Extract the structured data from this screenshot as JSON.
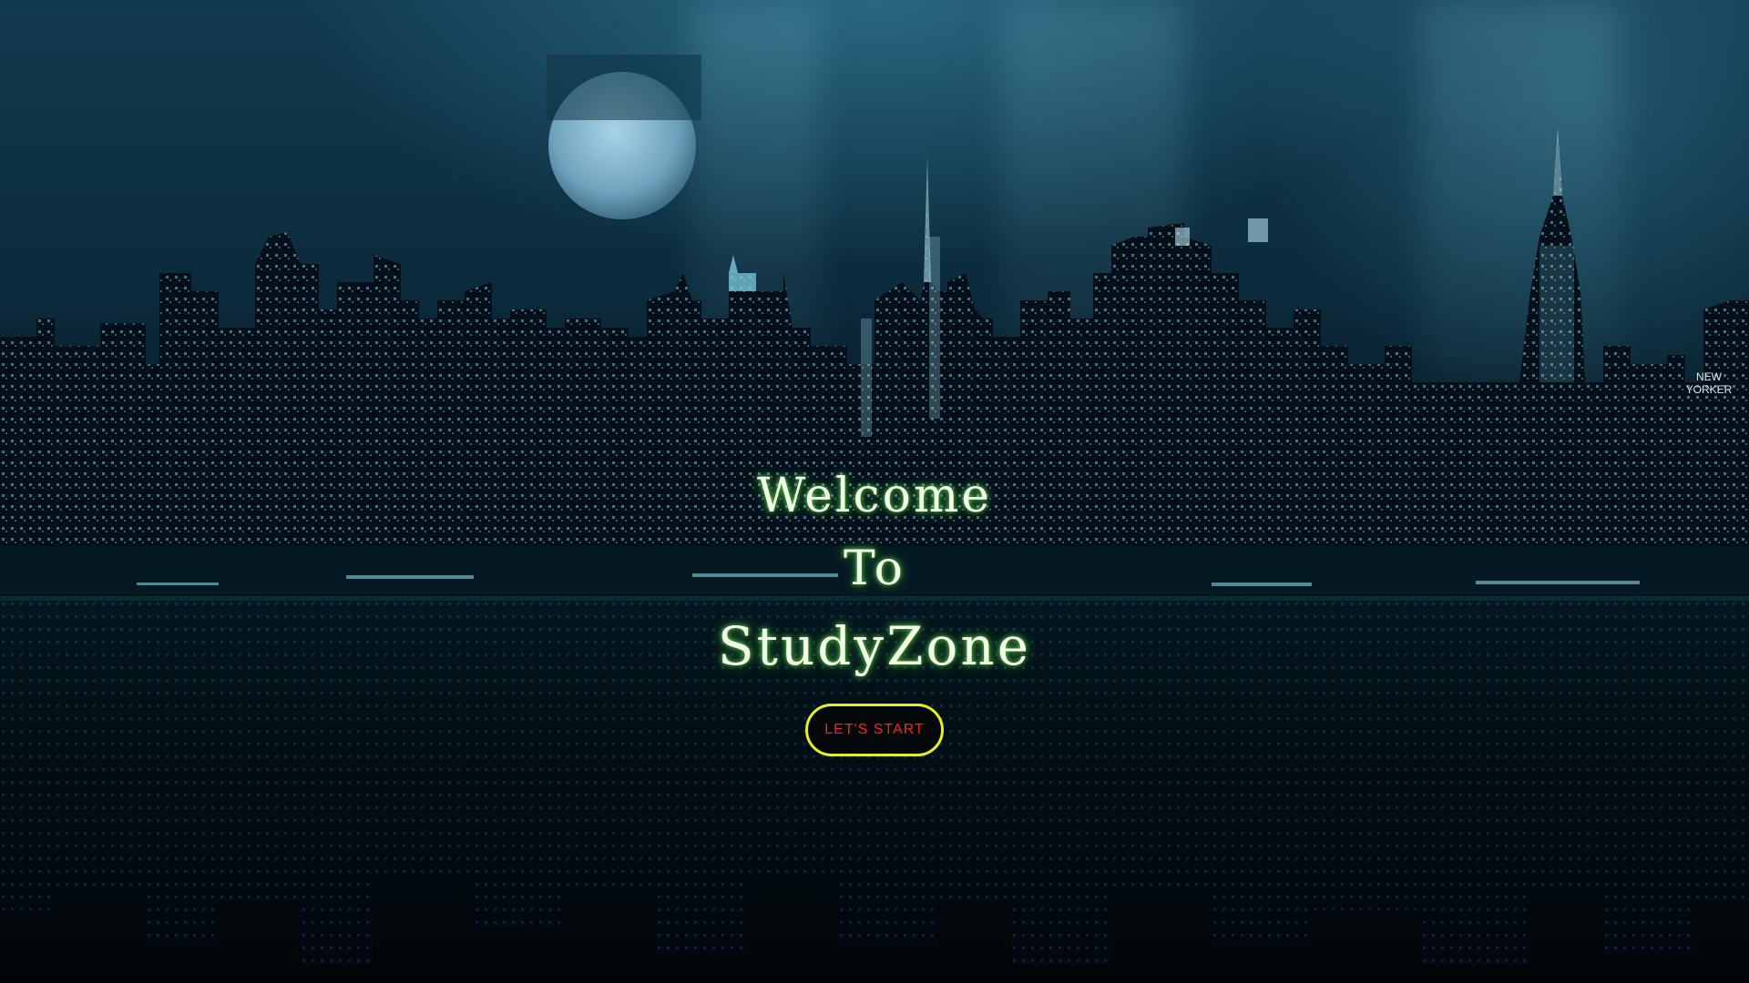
{
  "hero": {
    "line1": "Welcome",
    "line2": "To",
    "line3": "StudyZone"
  },
  "cta": {
    "label": "LET'S START"
  },
  "background": {
    "sign_text_1": "NEW",
    "sign_text_2": "YORKER"
  },
  "colors": {
    "headline_text": "#f2ffe9",
    "headline_glow": "#78ff5a",
    "button_border": "#e6f21c",
    "button_text": "#ff1f1f",
    "button_bg": "#05080b"
  }
}
